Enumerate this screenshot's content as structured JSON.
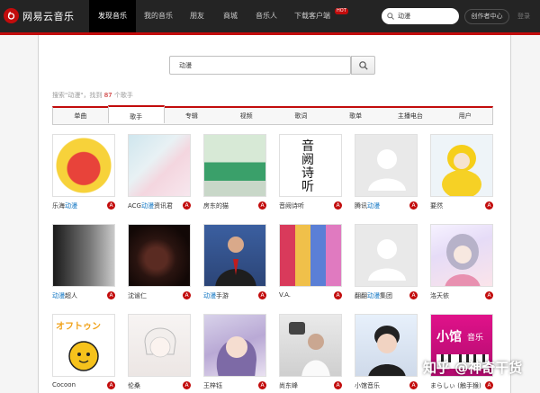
{
  "app": {
    "logo_text": "网易云音乐"
  },
  "nav": {
    "items": [
      "发现音乐",
      "我的音乐",
      "朋友",
      "商城",
      "音乐人",
      "下载客户端"
    ],
    "hot_badge": "HOT",
    "search_value": "动漫",
    "creator_center": "创作者中心",
    "login": "登录"
  },
  "search": {
    "value": "动漫"
  },
  "result_info": {
    "prefix": "搜索\"动漫\"，找到",
    "count": "87",
    "suffix": "个歌手"
  },
  "tabs": [
    "单曲",
    "歌手",
    "专辑",
    "视频",
    "歌词",
    "歌单",
    "主播电台",
    "用户"
  ],
  "active_tab": "歌手",
  "artists": [
    [
      {
        "pre": "乐海",
        "hl": "动漫",
        "post": ""
      },
      {
        "pre": "ACG",
        "hl": "动漫",
        "post": "资讯君"
      },
      {
        "pre": "房东的猫",
        "hl": "",
        "post": ""
      },
      {
        "pre": "音阙诗听",
        "hl": "",
        "post": ""
      },
      {
        "pre": "腾讯",
        "hl": "动漫",
        "post": ""
      },
      {
        "pre": "要然",
        "hl": "",
        "post": ""
      }
    ],
    [
      {
        "pre": "",
        "hl": "动漫",
        "post": "超人"
      },
      {
        "pre": "沈谧仁",
        "hl": "",
        "post": ""
      },
      {
        "pre": "",
        "hl": "动漫",
        "post": "手游"
      },
      {
        "pre": "V.A.",
        "hl": "",
        "post": ""
      },
      {
        "pre": "翻翻",
        "hl": "动漫",
        "post": "集团"
      },
      {
        "pre": "洛天依",
        "hl": "",
        "post": ""
      }
    ],
    [
      {
        "pre": "Cocoon",
        "hl": "",
        "post": ""
      },
      {
        "pre": "伦桑",
        "hl": "",
        "post": ""
      },
      {
        "pre": "王梓钰",
        "hl": "",
        "post": ""
      },
      {
        "pre": "尚东峰",
        "hl": "",
        "post": ""
      },
      {
        "pre": "小馆音乐",
        "hl": "",
        "post": ""
      },
      {
        "pre": "まらしぃ (触手猴)",
        "hl": "",
        "post": ""
      }
    ]
  ],
  "thumb_labels": {
    "ink_title": "音阙诗听",
    "music_label": "音乐",
    "small_label": "小馆",
    "orange_text": "オフトゥン"
  },
  "badge_label": "A",
  "watermark": "知乎 @神奇干货",
  "colors": {
    "brand_red": "#c20c0c",
    "highlight_blue": "#0c73c2",
    "nav_bg": "#242424"
  }
}
